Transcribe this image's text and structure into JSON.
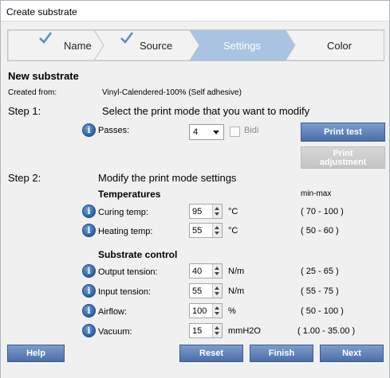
{
  "window": {
    "title": "Create substrate"
  },
  "wizard": {
    "steps": [
      {
        "label": "Name",
        "state": "done"
      },
      {
        "label": "Source",
        "state": "done"
      },
      {
        "label": "Settings",
        "state": "active"
      },
      {
        "label": "Color",
        "state": "pending"
      }
    ]
  },
  "header": {
    "title": "New substrate",
    "created_from_label": "Created from:",
    "created_from_value": "Vinyl-Calendered-100% (Self adhesive)"
  },
  "step1": {
    "label": "Step 1:",
    "instruction": "Select the print mode that you want to modify",
    "passes_label": "Passes:",
    "passes_value": "4",
    "bidi_label": "Bidi",
    "bidi_checked": false,
    "print_test_label": "Print test",
    "print_adjustment_label_1": "Print",
    "print_adjustment_label_2": "adjustment"
  },
  "step2": {
    "label": "Step 2:",
    "instruction": "Modify the print mode settings",
    "range_header": "min-max",
    "temperatures": {
      "heading": "Temperatures",
      "curing": {
        "label": "Curing temp:",
        "value": "95",
        "unit": "°C",
        "range": "( 70 - 100 )"
      },
      "heating": {
        "label": "Heating temp:",
        "value": "55",
        "unit": "°C",
        "range": "( 50 - 60 )"
      }
    },
    "substrate_control": {
      "heading": "Substrate control",
      "output_tension": {
        "label": "Output tension:",
        "value": "40",
        "unit": "N/m",
        "range": "( 25 - 65 )"
      },
      "input_tension": {
        "label": "Input tension:",
        "value": "55",
        "unit": "N/m",
        "range": "( 55 - 75 )"
      },
      "airflow": {
        "label": "Airflow:",
        "value": "100",
        "unit": "%",
        "range": "( 50 - 100 )"
      },
      "vacuum": {
        "label": "Vacuum:",
        "value": "15",
        "unit": "mmH2O",
        "range": "( 1.00 - 35.00 )"
      }
    }
  },
  "footer": {
    "help_label": "Help",
    "reset_label": "Reset",
    "finish_label": "Finish",
    "next_label": "Next"
  },
  "icons": {
    "info": "info-icon",
    "check": "checkmark-icon"
  },
  "colors": {
    "accent": "#4b6fa8",
    "active_step": "#a9c3e3"
  }
}
